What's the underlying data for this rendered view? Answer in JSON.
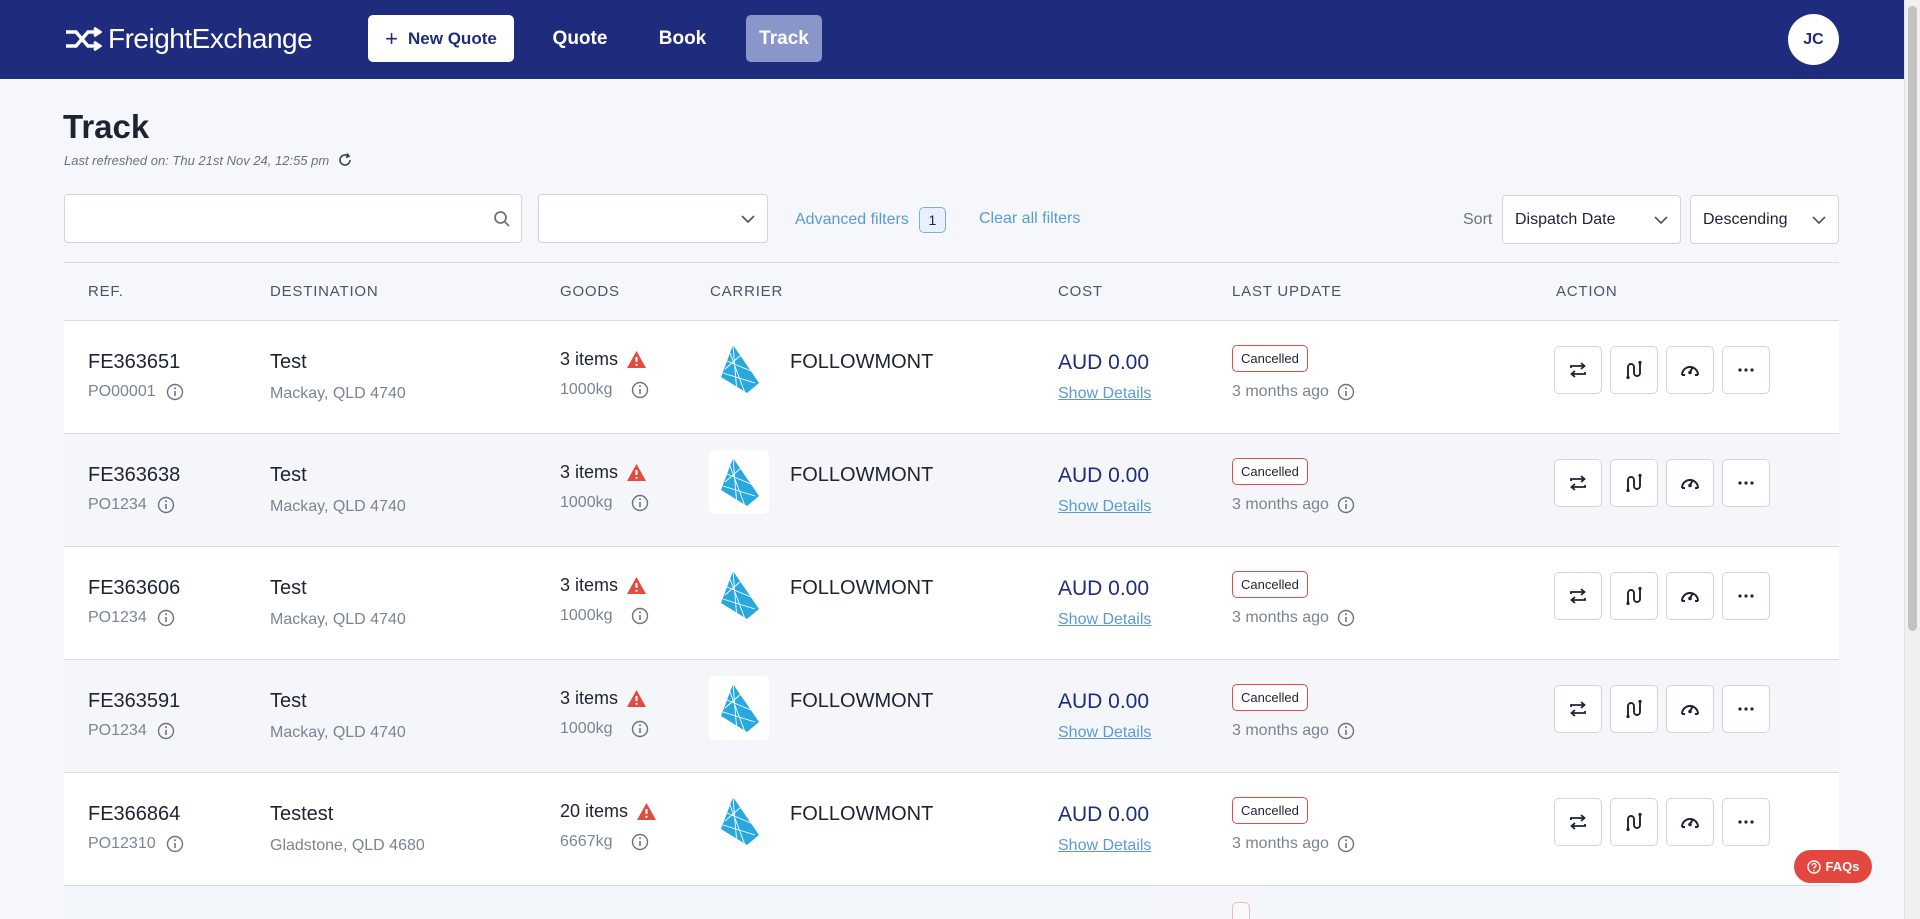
{
  "nav": {
    "brand": "FreightExchange",
    "new_quote": "New Quote",
    "quote": "Quote",
    "book": "Book",
    "track": "Track",
    "avatar": "JC"
  },
  "header": {
    "title": "Track",
    "last_refreshed": "Last refreshed on: Thu 21st Nov 24, 12:55 pm"
  },
  "filters": {
    "search_value": "",
    "advanced_filters": "Advanced filters",
    "advanced_count": "1",
    "clear_all": "Clear all filters",
    "sort_label": "Sort",
    "sort_by": "Dispatch Date",
    "sort_dir": "Descending"
  },
  "table": {
    "columns": [
      "REF.",
      "DESTINATION",
      "GOODS",
      "CARRIER",
      "COST",
      "LAST UPDATE",
      "ACTION"
    ],
    "rows": [
      {
        "ref": "FE363651",
        "po": "PO00001",
        "dest": "Test",
        "dest_sub": "Mackay, QLD 4740",
        "goods": "3 items",
        "weight": "1000kg",
        "carrier": "FOLLOWMONT",
        "cost": "AUD 0.00",
        "details": "Show Details",
        "status": "Cancelled",
        "updated": "3 months ago"
      },
      {
        "ref": "FE363638",
        "po": "PO1234",
        "dest": "Test",
        "dest_sub": "Mackay, QLD 4740",
        "goods": "3 items",
        "weight": "1000kg",
        "carrier": "FOLLOWMONT",
        "cost": "AUD 0.00",
        "details": "Show Details",
        "status": "Cancelled",
        "updated": "3 months ago"
      },
      {
        "ref": "FE363606",
        "po": "PO1234",
        "dest": "Test",
        "dest_sub": "Mackay, QLD 4740",
        "goods": "3 items",
        "weight": "1000kg",
        "carrier": "FOLLOWMONT",
        "cost": "AUD 0.00",
        "details": "Show Details",
        "status": "Cancelled",
        "updated": "3 months ago"
      },
      {
        "ref": "FE363591",
        "po": "PO1234",
        "dest": "Test",
        "dest_sub": "Mackay, QLD 4740",
        "goods": "3 items",
        "weight": "1000kg",
        "carrier": "FOLLOWMONT",
        "cost": "AUD 0.00",
        "details": "Show Details",
        "status": "Cancelled",
        "updated": "3 months ago"
      },
      {
        "ref": "FE366864",
        "po": "PO12310",
        "dest": "Testest",
        "dest_sub": "Gladstone, QLD 4680",
        "goods": "20 items",
        "weight": "6667kg",
        "carrier": "FOLLOWMONT",
        "cost": "AUD 0.00",
        "details": "Show Details",
        "status": "Cancelled",
        "updated": "3 months ago"
      }
    ]
  },
  "faq": "FAQs",
  "colors": {
    "nav_bg": "#1f2c7e",
    "accent_link": "#5b9bd5",
    "status_border": "#e44b4b",
    "carrier_blue": "#29a8e0",
    "warning": "#e44b3f"
  }
}
